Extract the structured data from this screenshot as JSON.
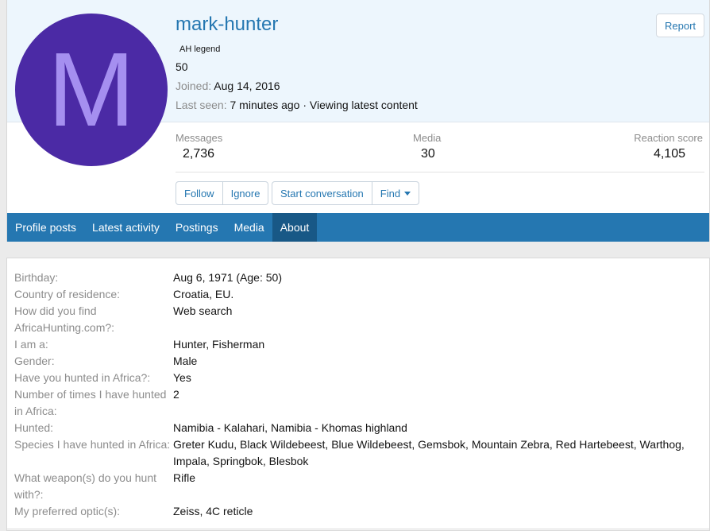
{
  "profile": {
    "avatar_letter": "M",
    "username": "mark-hunter",
    "user_title": "AH legend",
    "count": "50",
    "joined_label": "Joined:",
    "joined_value": "Aug 14, 2016",
    "lastseen_label": "Last seen:",
    "lastseen_value": "7 minutes ago · Viewing latest content",
    "report_label": "Report"
  },
  "stats": {
    "messages_label": "Messages",
    "messages_value": "2,736",
    "media_label": "Media",
    "media_value": "30",
    "reaction_label": "Reaction score",
    "reaction_value": "4,105"
  },
  "actions": {
    "follow": "Follow",
    "ignore": "Ignore",
    "start_conversation": "Start conversation",
    "find": "Find"
  },
  "tabs": [
    {
      "label": "Profile posts"
    },
    {
      "label": "Latest activity"
    },
    {
      "label": "Postings"
    },
    {
      "label": "Media"
    },
    {
      "label": "About"
    }
  ],
  "about": [
    {
      "dt": "Birthday:",
      "dd": "Aug 6, 1971 (Age: 50)"
    },
    {
      "dt": "Country of residence:",
      "dd": "Croatia, EU."
    },
    {
      "dt": "How did you find AfricaHunting.com?:",
      "dd": "Web search"
    },
    {
      "dt": "I am a:",
      "dd": "Hunter, Fisherman"
    },
    {
      "dt": "Gender:",
      "dd": "Male"
    },
    {
      "dt": "Have you hunted in Africa?:",
      "dd": "Yes"
    },
    {
      "dt": "Number of times I have hunted in Africa:",
      "dd": "2"
    },
    {
      "dt": "Hunted:",
      "dd": "Namibia - Kalahari, Namibia - Khomas highland"
    },
    {
      "dt": "Species I have hunted in Africa:",
      "dd": "Greter Kudu, Black Wildebeest, Blue Wildebeest, Gemsbok, Mountain Zebra, Red Hartebeest, Warthog, Impala, Springbok, Blesbok"
    },
    {
      "dt": "What weapon(s) do you hunt with?:",
      "dd": "Rifle"
    },
    {
      "dt": "My preferred optic(s):",
      "dd": "Zeiss, 4C reticle"
    }
  ],
  "colors": {
    "accent": "#2577b1",
    "tab_active": "#185886",
    "avatar_bg": "#4b2aa5",
    "highlight": "#fbfb3c"
  }
}
